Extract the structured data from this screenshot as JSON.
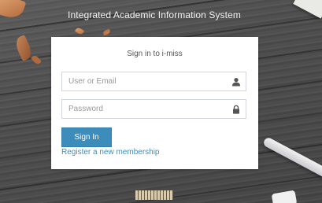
{
  "header": {
    "app_title": "Integrated Academic Information System"
  },
  "login": {
    "title": "Sign in to i-miss",
    "user_placeholder": "User or Email",
    "user_value": "",
    "password_placeholder": "Password",
    "password_value": "",
    "user_icon": "user-icon",
    "password_icon": "lock-icon",
    "signin_label": "Sign In",
    "register_label": "Register a new membership"
  },
  "colors": {
    "accent": "#3c8dbc",
    "link": "#3c8dbc",
    "card_background": "#ffffff"
  }
}
